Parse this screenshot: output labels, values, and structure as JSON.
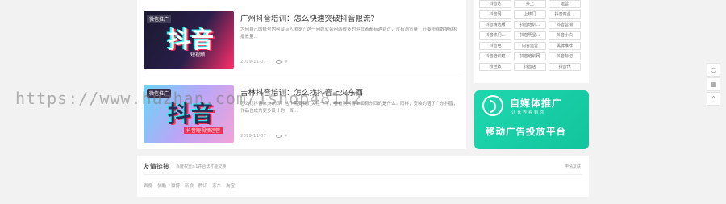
{
  "articles": [
    {
      "title": "广州抖音培训：怎么快速突破抖音限流?",
      "desc": "为何自己的账号内容没有人浏览？这一问题就会困惑很多的运营者都有遇到过，没有浏览量，节奏粉丝数据就和播放量...",
      "date": "2019-11-07",
      "views": "0",
      "thumb_tag": "微信推广",
      "thumb_logo": "抖音",
      "thumb_sub": "短视频"
    },
    {
      "title": "吉林抖音培训：怎么找抖音上火东西",
      "desc": "怎么找抖音上火东西？这个需要我们关注一下，看看到抖音上面有东西的是什么。同样，安装的话了广东抖音，作品也成为更多设计的，百...",
      "date": "2019-11-07",
      "views": "4",
      "thumb_tag": "微信推广",
      "thumb_logo": "抖音",
      "thumb_sub": "抖音短视频运营"
    }
  ],
  "sidebar": {
    "tags": [
      "抖音达",
      "抖上",
      "运营",
      "抖音网",
      "上热门",
      "抖音商业...",
      "抖音精选版",
      "抖音培训...",
      "抖音营销",
      "抖音热门...",
      "抖音明星...",
      "抖音小白",
      "抖音电",
      "内容运营",
      "黑牌推荐",
      "抖音培训班",
      "抖音培训网",
      "抖音标记",
      "粉丝数",
      "抖音店",
      "抖音代"
    ]
  },
  "ad": {
    "title": "自媒体推广",
    "subtitle": "让世界看到你",
    "main": "移动广告投放平台"
  },
  "links": {
    "title": "友情链接",
    "note": "百度权重≥1并合法才能交换",
    "apply": "申请友联",
    "items": [
      "百度",
      "优酷",
      "微博",
      "新浪",
      "腾讯",
      "京东",
      "淘宝"
    ]
  },
  "float_bar": {
    "icons": [
      "comment-icon",
      "qrcode-icon",
      "back-to-top-icon"
    ]
  },
  "watermark": "https://www.huzhan.com/1shop48112"
}
